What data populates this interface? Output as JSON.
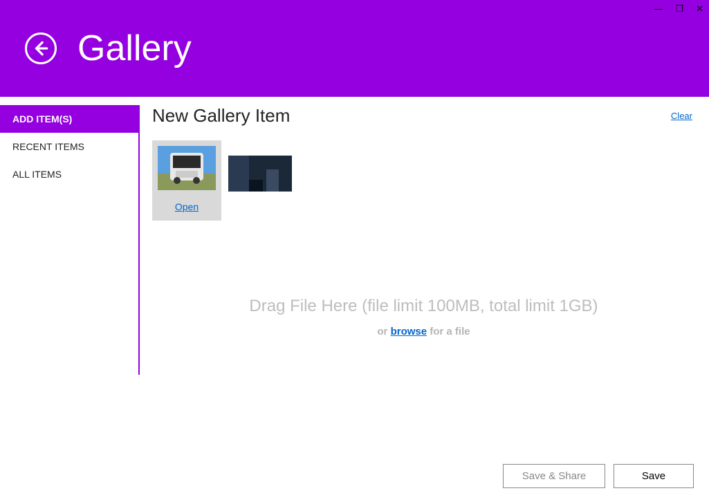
{
  "window_controls": {
    "min": "—",
    "max": "❐",
    "close": "✕"
  },
  "header": {
    "title": "Gallery"
  },
  "sidebar": {
    "items": [
      {
        "label": "ADD ITEM(S)",
        "active": true
      },
      {
        "label": "RECENT ITEMS",
        "active": false
      },
      {
        "label": "ALL ITEMS",
        "active": false
      }
    ]
  },
  "main": {
    "title": "New Gallery Item",
    "clear": "Clear",
    "thumbs": {
      "open_label": "Open"
    },
    "dropzone": {
      "big": "Drag File Here (file limit 100MB, total limit 1GB)",
      "or": "or ",
      "browse": "browse",
      "rest": " for a file"
    }
  },
  "footer": {
    "share": "Save & Share",
    "save": "Save"
  }
}
